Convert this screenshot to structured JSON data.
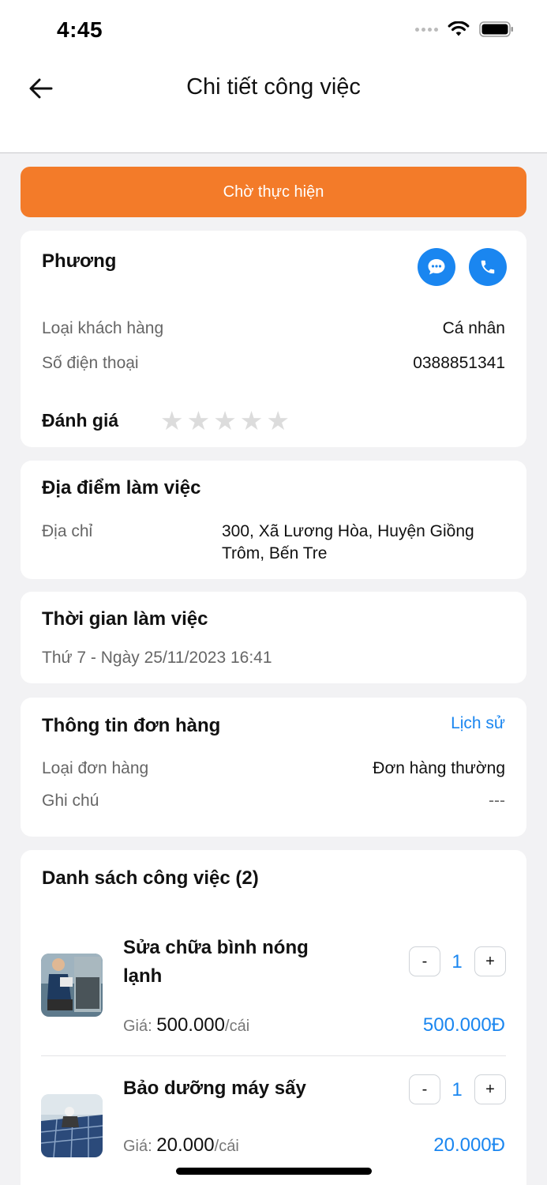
{
  "status_bar": {
    "time": "4:45"
  },
  "nav": {
    "title": "Chi tiết công việc"
  },
  "job_status": "Chờ thực hiện",
  "customer": {
    "name": "Phương",
    "type_label": "Loại khách hàng",
    "type_value": "Cá nhân",
    "phone_label": "Số điện thoại",
    "phone_value": "0388851341",
    "rating_label": "Đánh giá",
    "rating": 0,
    "rating_max": 5
  },
  "location": {
    "title": "Địa điểm làm việc",
    "address_label": "Địa chỉ",
    "address_value": "300, Xã Lương Hòa, Huyện Giồng Trôm, Bến Tre"
  },
  "work_time": {
    "title": "Thời gian làm việc",
    "value": "Thứ 7 - Ngày 25/11/2023 16:41"
  },
  "order": {
    "title": "Thông tin đơn hàng",
    "history_link": "Lịch sử",
    "type_label": "Loại đơn hàng",
    "type_value": "Đơn hàng thường",
    "note_label": "Ghi chú",
    "note_value": "---"
  },
  "jobs": {
    "title": "Danh sách công việc (2)",
    "items": [
      {
        "name": "Sửa chữa bình nóng lạnh",
        "minus": "-",
        "qty": "1",
        "plus": "+",
        "price_prefix": "Giá: ",
        "price": "500.000",
        "unit": "/cái",
        "total": "500.000Đ"
      },
      {
        "name": "Bảo dưỡng máy sấy",
        "minus": "-",
        "qty": "1",
        "plus": "+",
        "price_prefix": "Giá: ",
        "price": "20.000",
        "unit": "/cái",
        "total": "20.000Đ"
      }
    ]
  },
  "colors": {
    "accent_orange": "#f37b29",
    "accent_blue": "#1a86f0",
    "background": "#f2f2f4"
  }
}
